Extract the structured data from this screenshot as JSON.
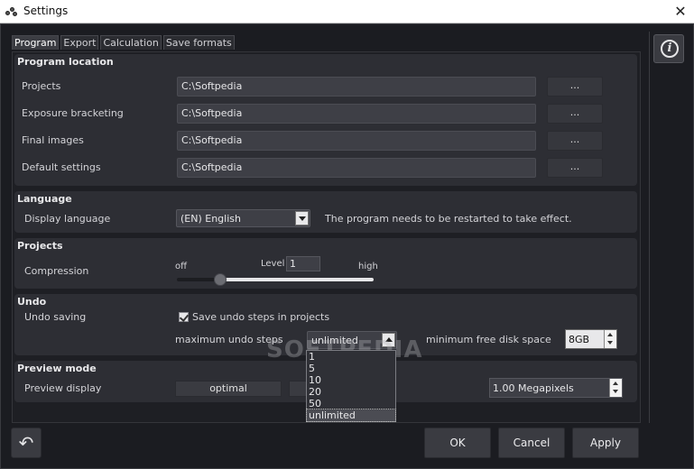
{
  "window": {
    "title": "Settings"
  },
  "tabs": [
    "Program",
    "Export",
    "Calculation",
    "Save formats"
  ],
  "program_location": {
    "title": "Program location",
    "rows": [
      {
        "label": "Projects",
        "value": "C:\\Softpedia",
        "button": "..."
      },
      {
        "label": "Exposure bracketing",
        "value": "C:\\Softpedia",
        "button": "..."
      },
      {
        "label": "Final images",
        "value": "C:\\Softpedia",
        "button": "..."
      },
      {
        "label": "Default settings",
        "value": "C:\\Softpedia",
        "button": "..."
      }
    ]
  },
  "language": {
    "title": "Language",
    "label": "Display language",
    "value": "(EN) English",
    "note": "The program needs to be restarted to take effect."
  },
  "projects": {
    "title": "Projects",
    "label": "Compression",
    "min_label": "off",
    "max_label": "high",
    "level_label": "Level",
    "level_value": "1",
    "slider_fraction": 0.22
  },
  "undo": {
    "title": "Undo",
    "label": "Undo saving",
    "checkbox_label": "Save undo steps in projects",
    "checked": true,
    "max_steps_label": "maximum undo steps",
    "max_steps_value": "unlimited",
    "free_space_label": "minimum free disk space",
    "free_space_value": "8GB",
    "options": [
      "1",
      "5",
      "10",
      "20",
      "50",
      "unlimited"
    ]
  },
  "preview": {
    "title": "Preview mode",
    "label": "Preview display",
    "mode_button": "optimal",
    "megapixels": "1.00 Megapixels"
  },
  "footer": {
    "ok": "OK",
    "cancel": "Cancel",
    "apply": "Apply"
  },
  "watermark": "SOFTPEDIA"
}
